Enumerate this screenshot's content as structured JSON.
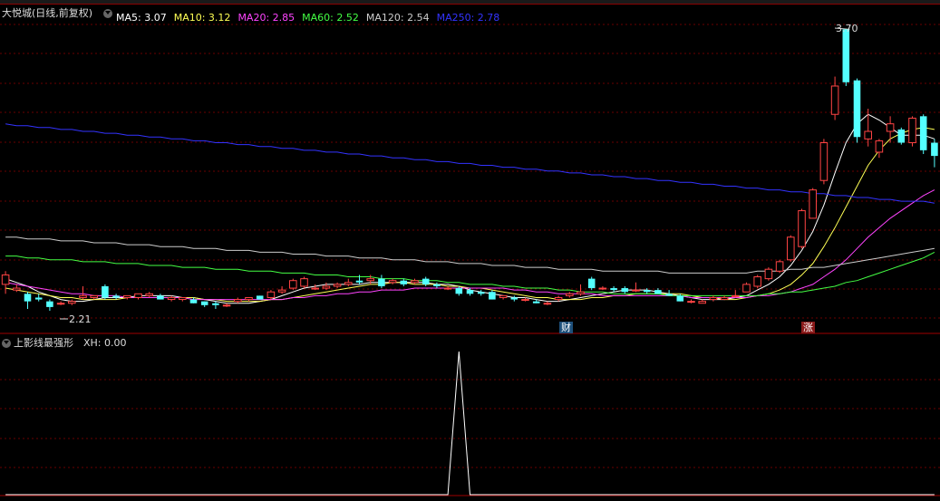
{
  "main_panel": {
    "stock_title": "大悦城(日线,前复权)",
    "ma_labels": [
      {
        "text": "MA5: 3.07",
        "color": "#ffffff"
      },
      {
        "text": "MA10: 3.12",
        "color": "#ffff55"
      },
      {
        "text": "MA20: 2.85",
        "color": "#ff44ff"
      },
      {
        "text": "MA60: 2.52",
        "color": "#44ff44"
      },
      {
        "text": "MA120: 2.54",
        "color": "#cccccc"
      },
      {
        "text": "MA250: 2.78",
        "color": "#3333ff"
      }
    ],
    "high_label": "3.70",
    "low_label": "2.21",
    "event_tags": {
      "finance": "财",
      "rise": "涨"
    }
  },
  "sub_panel": {
    "indicator_name": "上影线最强形",
    "value_label": "XH: 0.00"
  },
  "chart_data": {
    "type": "candlestick",
    "price_range": [
      2.1,
      3.75
    ],
    "candles": [
      [
        2.35,
        2.4,
        2.3,
        2.42
      ],
      [
        2.32,
        2.33,
        2.31,
        2.35
      ],
      [
        2.3,
        2.26,
        2.22,
        2.31
      ],
      [
        2.28,
        2.27,
        2.26,
        2.3
      ],
      [
        2.26,
        2.23,
        2.21,
        2.27
      ],
      [
        2.25,
        2.25,
        2.24,
        2.26
      ],
      [
        2.25,
        2.26,
        2.24,
        2.27
      ],
      [
        2.28,
        2.29,
        2.27,
        2.34
      ],
      [
        2.28,
        2.29,
        2.27,
        2.29
      ],
      [
        2.34,
        2.28,
        2.27,
        2.35
      ],
      [
        2.29,
        2.28,
        2.27,
        2.3
      ],
      [
        2.28,
        2.29,
        2.27,
        2.29
      ],
      [
        2.28,
        2.3,
        2.27,
        2.3
      ],
      [
        2.29,
        2.3,
        2.28,
        2.31
      ],
      [
        2.29,
        2.27,
        2.27,
        2.3
      ],
      [
        2.27,
        2.28,
        2.26,
        2.29
      ],
      [
        2.27,
        2.28,
        2.26,
        2.28
      ],
      [
        2.27,
        2.25,
        2.25,
        2.28
      ],
      [
        2.26,
        2.24,
        2.23,
        2.26
      ],
      [
        2.25,
        2.24,
        2.22,
        2.26
      ],
      [
        2.24,
        2.24,
        2.23,
        2.25
      ],
      [
        2.26,
        2.27,
        2.25,
        2.28
      ],
      [
        2.27,
        2.28,
        2.26,
        2.28
      ],
      [
        2.29,
        2.27,
        2.27,
        2.29
      ],
      [
        2.28,
        2.31,
        2.27,
        2.32
      ],
      [
        2.31,
        2.32,
        2.3,
        2.34
      ],
      [
        2.33,
        2.37,
        2.32,
        2.38
      ],
      [
        2.34,
        2.38,
        2.33,
        2.39
      ],
      [
        2.33,
        2.33,
        2.32,
        2.35
      ],
      [
        2.33,
        2.34,
        2.32,
        2.36
      ],
      [
        2.34,
        2.35,
        2.33,
        2.36
      ],
      [
        2.35,
        2.36,
        2.34,
        2.38
      ],
      [
        2.37,
        2.36,
        2.35,
        2.4
      ],
      [
        2.37,
        2.38,
        2.35,
        2.4
      ],
      [
        2.38,
        2.34,
        2.33,
        2.4
      ],
      [
        2.36,
        2.37,
        2.35,
        2.38
      ],
      [
        2.37,
        2.35,
        2.34,
        2.38
      ],
      [
        2.36,
        2.37,
        2.35,
        2.38
      ],
      [
        2.38,
        2.35,
        2.34,
        2.39
      ],
      [
        2.35,
        2.34,
        2.33,
        2.36
      ],
      [
        2.33,
        2.33,
        2.32,
        2.34
      ],
      [
        2.33,
        2.3,
        2.29,
        2.34
      ],
      [
        2.32,
        2.3,
        2.29,
        2.33
      ],
      [
        2.31,
        2.3,
        2.29,
        2.32
      ],
      [
        2.31,
        2.27,
        2.27,
        2.32
      ],
      [
        2.28,
        2.29,
        2.27,
        2.29
      ],
      [
        2.28,
        2.27,
        2.26,
        2.29
      ],
      [
        2.27,
        2.27,
        2.26,
        2.28
      ],
      [
        2.26,
        2.25,
        2.25,
        2.27
      ],
      [
        2.25,
        2.25,
        2.24,
        2.26
      ],
      [
        2.27,
        2.28,
        2.26,
        2.29
      ],
      [
        2.29,
        2.3,
        2.28,
        2.31
      ],
      [
        2.3,
        2.31,
        2.29,
        2.35
      ],
      [
        2.38,
        2.33,
        2.32,
        2.39
      ],
      [
        2.33,
        2.33,
        2.32,
        2.34
      ],
      [
        2.33,
        2.32,
        2.31,
        2.34
      ],
      [
        2.33,
        2.31,
        2.3,
        2.34
      ],
      [
        2.32,
        2.32,
        2.31,
        2.36
      ],
      [
        2.32,
        2.31,
        2.3,
        2.33
      ],
      [
        2.32,
        2.3,
        2.3,
        2.33
      ],
      [
        2.3,
        2.29,
        2.29,
        2.32
      ],
      [
        2.29,
        2.26,
        2.26,
        2.3
      ],
      [
        2.26,
        2.26,
        2.25,
        2.27
      ],
      [
        2.25,
        2.26,
        2.25,
        2.27
      ],
      [
        2.27,
        2.28,
        2.26,
        2.29
      ],
      [
        2.27,
        2.28,
        2.27,
        2.29
      ],
      [
        2.29,
        2.29,
        2.28,
        2.32
      ],
      [
        2.31,
        2.35,
        2.31,
        2.36
      ],
      [
        2.34,
        2.39,
        2.33,
        2.4
      ],
      [
        2.38,
        2.43,
        2.37,
        2.44
      ],
      [
        2.42,
        2.47,
        2.41,
        2.48
      ],
      [
        2.48,
        2.6,
        2.47,
        2.61
      ],
      [
        2.55,
        2.74,
        2.54,
        2.75
      ],
      [
        2.7,
        2.85,
        2.7,
        2.86
      ],
      [
        2.9,
        3.1,
        2.88,
        3.12
      ],
      [
        3.25,
        3.4,
        3.22,
        3.45
      ],
      [
        3.7,
        3.42,
        3.4,
        3.7
      ],
      [
        3.43,
        3.13,
        3.1,
        3.44
      ],
      [
        3.12,
        3.16,
        3.08,
        3.28
      ],
      [
        3.05,
        3.11,
        3.02,
        3.12
      ],
      [
        3.16,
        3.2,
        3.1,
        3.24
      ],
      [
        3.17,
        3.1,
        3.09,
        3.18
      ],
      [
        3.1,
        3.23,
        3.08,
        3.24
      ],
      [
        3.24,
        3.06,
        3.04,
        3.25
      ],
      [
        3.1,
        3.03,
        2.97,
        3.12
      ]
    ],
    "ma_series": [
      {
        "name": "MA5",
        "color": "#ffffff",
        "values": [
          2.38,
          2.36,
          2.34,
          2.31,
          2.29,
          2.27,
          2.26,
          2.26,
          2.27,
          2.28,
          2.28,
          2.28,
          2.29,
          2.29,
          2.29,
          2.29,
          2.28,
          2.28,
          2.27,
          2.26,
          2.25,
          2.25,
          2.25,
          2.26,
          2.27,
          2.29,
          2.31,
          2.33,
          2.34,
          2.35,
          2.35,
          2.35,
          2.35,
          2.36,
          2.36,
          2.36,
          2.36,
          2.36,
          2.36,
          2.35,
          2.35,
          2.34,
          2.32,
          2.31,
          2.3,
          2.29,
          2.28,
          2.28,
          2.27,
          2.26,
          2.26,
          2.27,
          2.28,
          2.29,
          2.3,
          2.31,
          2.32,
          2.32,
          2.32,
          2.31,
          2.3,
          2.29,
          2.28,
          2.27,
          2.27,
          2.27,
          2.28,
          2.29,
          2.32,
          2.35,
          2.39,
          2.45,
          2.53,
          2.63,
          2.77,
          2.94,
          3.1,
          3.2,
          3.25,
          3.22,
          3.18,
          3.14,
          3.14,
          3.14,
          3.12
        ]
      },
      {
        "name": "MA10",
        "color": "#ffff55",
        "values": [
          2.33,
          2.32,
          2.31,
          2.3,
          2.29,
          2.28,
          2.28,
          2.27,
          2.27,
          2.27,
          2.27,
          2.28,
          2.28,
          2.28,
          2.28,
          2.28,
          2.28,
          2.28,
          2.27,
          2.27,
          2.26,
          2.26,
          2.26,
          2.26,
          2.27,
          2.27,
          2.28,
          2.29,
          2.3,
          2.31,
          2.32,
          2.33,
          2.34,
          2.35,
          2.35,
          2.36,
          2.36,
          2.35,
          2.35,
          2.35,
          2.34,
          2.34,
          2.33,
          2.33,
          2.32,
          2.31,
          2.3,
          2.29,
          2.28,
          2.28,
          2.27,
          2.27,
          2.27,
          2.28,
          2.28,
          2.29,
          2.29,
          2.3,
          2.3,
          2.3,
          2.3,
          2.3,
          2.29,
          2.28,
          2.28,
          2.27,
          2.27,
          2.28,
          2.29,
          2.3,
          2.32,
          2.35,
          2.4,
          2.46,
          2.55,
          2.65,
          2.76,
          2.87,
          2.98,
          3.06,
          3.12,
          3.15,
          3.17,
          3.18,
          3.17
        ]
      },
      {
        "name": "MA20",
        "color": "#ff44ff",
        "values": [
          2.36,
          2.35,
          2.34,
          2.33,
          2.32,
          2.31,
          2.3,
          2.3,
          2.29,
          2.29,
          2.29,
          2.28,
          2.28,
          2.28,
          2.28,
          2.28,
          2.28,
          2.27,
          2.27,
          2.27,
          2.27,
          2.27,
          2.27,
          2.27,
          2.27,
          2.27,
          2.28,
          2.28,
          2.29,
          2.29,
          2.3,
          2.3,
          2.31,
          2.31,
          2.32,
          2.32,
          2.32,
          2.33,
          2.33,
          2.33,
          2.33,
          2.33,
          2.33,
          2.33,
          2.33,
          2.33,
          2.32,
          2.32,
          2.31,
          2.31,
          2.3,
          2.3,
          2.3,
          2.3,
          2.29,
          2.29,
          2.29,
          2.29,
          2.29,
          2.29,
          2.29,
          2.29,
          2.28,
          2.28,
          2.28,
          2.28,
          2.28,
          2.28,
          2.29,
          2.29,
          2.3,
          2.31,
          2.33,
          2.35,
          2.39,
          2.43,
          2.48,
          2.54,
          2.6,
          2.65,
          2.7,
          2.74,
          2.78,
          2.82,
          2.85
        ]
      },
      {
        "name": "MA60",
        "color": "#44ff44",
        "values": [
          2.5,
          2.5,
          2.49,
          2.49,
          2.48,
          2.48,
          2.48,
          2.47,
          2.47,
          2.47,
          2.46,
          2.46,
          2.46,
          2.45,
          2.45,
          2.45,
          2.44,
          2.44,
          2.44,
          2.43,
          2.43,
          2.43,
          2.42,
          2.42,
          2.42,
          2.41,
          2.41,
          2.41,
          2.4,
          2.4,
          2.4,
          2.39,
          2.39,
          2.39,
          2.38,
          2.38,
          2.38,
          2.37,
          2.37,
          2.37,
          2.36,
          2.36,
          2.35,
          2.35,
          2.35,
          2.34,
          2.34,
          2.33,
          2.33,
          2.33,
          2.32,
          2.32,
          2.31,
          2.31,
          2.31,
          2.3,
          2.3,
          2.3,
          2.3,
          2.3,
          2.29,
          2.29,
          2.29,
          2.29,
          2.29,
          2.29,
          2.29,
          2.29,
          2.29,
          2.3,
          2.3,
          2.31,
          2.31,
          2.32,
          2.33,
          2.34,
          2.36,
          2.37,
          2.39,
          2.41,
          2.43,
          2.45,
          2.47,
          2.49,
          2.52
        ]
      },
      {
        "name": "MA120",
        "color": "#cccccc",
        "values": [
          2.6,
          2.6,
          2.59,
          2.59,
          2.59,
          2.58,
          2.58,
          2.58,
          2.57,
          2.57,
          2.57,
          2.56,
          2.56,
          2.56,
          2.55,
          2.55,
          2.55,
          2.54,
          2.54,
          2.54,
          2.53,
          2.53,
          2.53,
          2.52,
          2.52,
          2.52,
          2.51,
          2.51,
          2.51,
          2.5,
          2.5,
          2.5,
          2.49,
          2.49,
          2.49,
          2.48,
          2.48,
          2.48,
          2.47,
          2.47,
          2.47,
          2.46,
          2.46,
          2.46,
          2.45,
          2.45,
          2.45,
          2.44,
          2.44,
          2.44,
          2.43,
          2.43,
          2.43,
          2.43,
          2.42,
          2.42,
          2.42,
          2.42,
          2.42,
          2.42,
          2.41,
          2.41,
          2.41,
          2.41,
          2.41,
          2.41,
          2.41,
          2.41,
          2.42,
          2.42,
          2.42,
          2.43,
          2.43,
          2.44,
          2.44,
          2.45,
          2.46,
          2.47,
          2.48,
          2.49,
          2.5,
          2.51,
          2.52,
          2.53,
          2.54
        ]
      },
      {
        "name": "MA250",
        "color": "#3333ff",
        "values": [
          3.2,
          3.19,
          3.19,
          3.18,
          3.18,
          3.17,
          3.17,
          3.16,
          3.16,
          3.15,
          3.15,
          3.14,
          3.14,
          3.13,
          3.13,
          3.12,
          3.12,
          3.11,
          3.11,
          3.1,
          3.1,
          3.09,
          3.09,
          3.08,
          3.08,
          3.07,
          3.07,
          3.06,
          3.06,
          3.05,
          3.05,
          3.04,
          3.04,
          3.03,
          3.03,
          3.02,
          3.02,
          3.01,
          3.01,
          3.0,
          3.0,
          2.99,
          2.99,
          2.98,
          2.98,
          2.97,
          2.97,
          2.96,
          2.96,
          2.95,
          2.95,
          2.94,
          2.94,
          2.93,
          2.93,
          2.92,
          2.92,
          2.91,
          2.91,
          2.9,
          2.9,
          2.89,
          2.89,
          2.88,
          2.88,
          2.87,
          2.87,
          2.86,
          2.86,
          2.85,
          2.85,
          2.84,
          2.84,
          2.83,
          2.83,
          2.82,
          2.82,
          2.81,
          2.81,
          2.8,
          2.8,
          2.79,
          2.79,
          2.79,
          2.78
        ]
      }
    ],
    "sub_indicator": {
      "name": "XH",
      "peak_index": 41,
      "range": [
        0,
        1
      ]
    },
    "grid": true
  }
}
